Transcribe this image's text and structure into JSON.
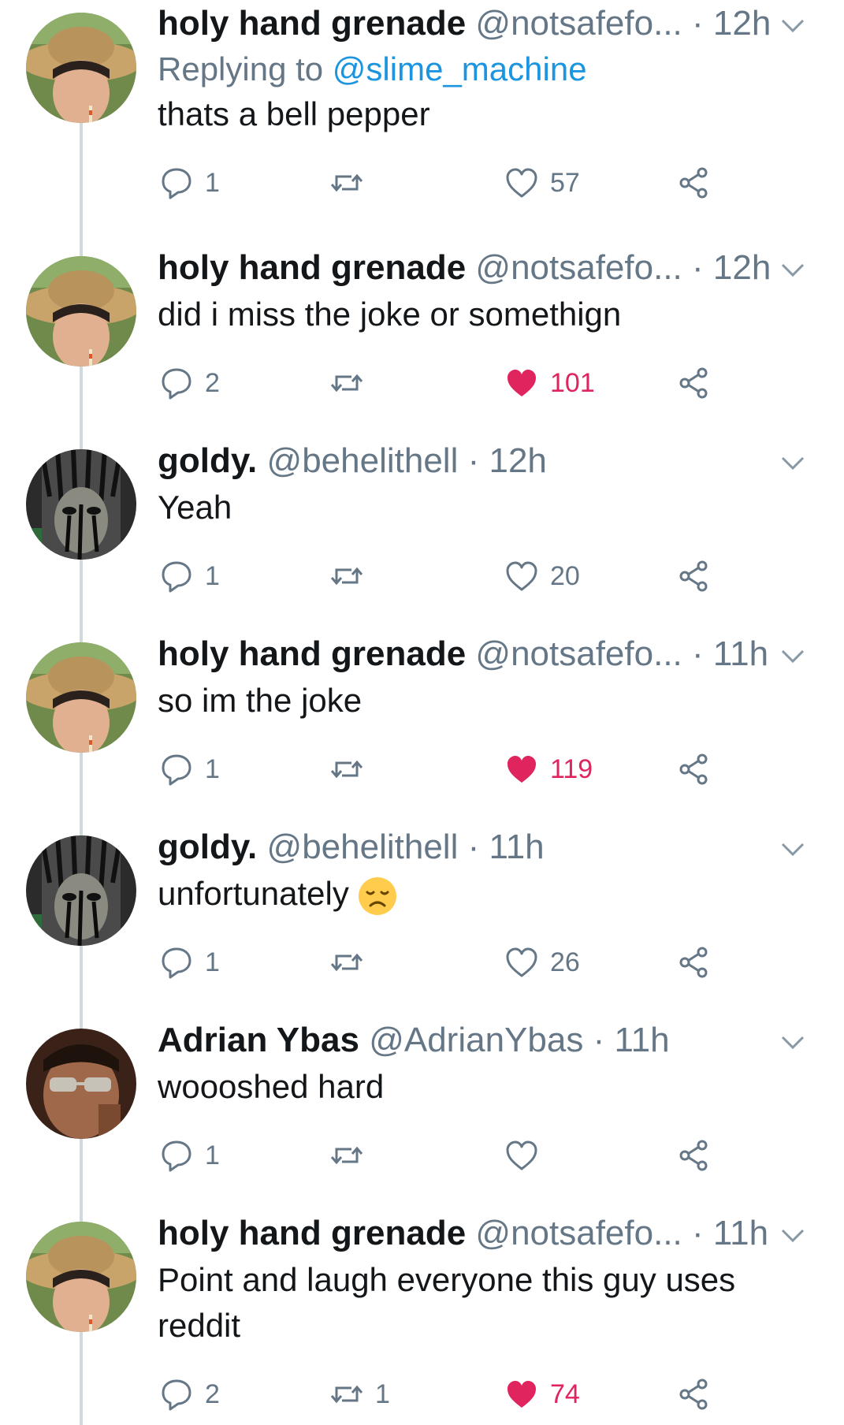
{
  "tweets": [
    {
      "name": "holy hand grenade",
      "handle": "@notsafefo...",
      "dot": "·",
      "time": "12h",
      "replying_prefix": "Replying to",
      "replying_to": "@slime_machine",
      "text": "thats a bell pepper",
      "reply_count": "1",
      "retweet_count": "",
      "like_count": "57",
      "liked": false,
      "avatar": "straw-hat-avatar"
    },
    {
      "name": "holy hand grenade",
      "handle": "@notsafefo...",
      "dot": "·",
      "time": "12h",
      "text": "did i miss the joke or somethign",
      "reply_count": "2",
      "retweet_count": "",
      "like_count": "101",
      "liked": true,
      "avatar": "straw-hat-avatar"
    },
    {
      "name": "goldy.",
      "handle": "@behelithell",
      "dot": "·",
      "time": "12h",
      "text": "Yeah",
      "reply_count": "1",
      "retweet_count": "",
      "like_count": "20",
      "liked": false,
      "avatar": "manga-avatar"
    },
    {
      "name": "holy hand grenade",
      "handle": "@notsafefo...",
      "dot": "·",
      "time": "11h",
      "text": "so im the joke",
      "reply_count": "1",
      "retweet_count": "",
      "like_count": "119",
      "liked": true,
      "avatar": "straw-hat-avatar"
    },
    {
      "name": "goldy.",
      "handle": "@behelithell",
      "dot": "·",
      "time": "11h",
      "text": "unfortunately",
      "emoji": "disappointed-face-emoji",
      "reply_count": "1",
      "retweet_count": "",
      "like_count": "26",
      "liked": false,
      "avatar": "manga-avatar"
    },
    {
      "name": "Adrian Ybas",
      "handle": "@AdrianYbas",
      "dot": "·",
      "time": "11h",
      "text": "woooshed hard",
      "reply_count": "1",
      "retweet_count": "",
      "like_count": "",
      "liked": false,
      "avatar": "sunglasses-avatar"
    },
    {
      "name": "holy hand grenade",
      "handle": "@notsafefo...",
      "dot": "·",
      "time": "11h",
      "text": "Point and laugh everyone this guy uses reddit",
      "reply_count": "2",
      "retweet_count": "1",
      "like_count": "74",
      "liked": true,
      "avatar": "straw-hat-avatar"
    }
  ],
  "colors": {
    "text": "#14171a",
    "muted": "#657786",
    "link": "#1b95e0",
    "like": "#e0245e",
    "thread_line": "#cfd9de"
  }
}
